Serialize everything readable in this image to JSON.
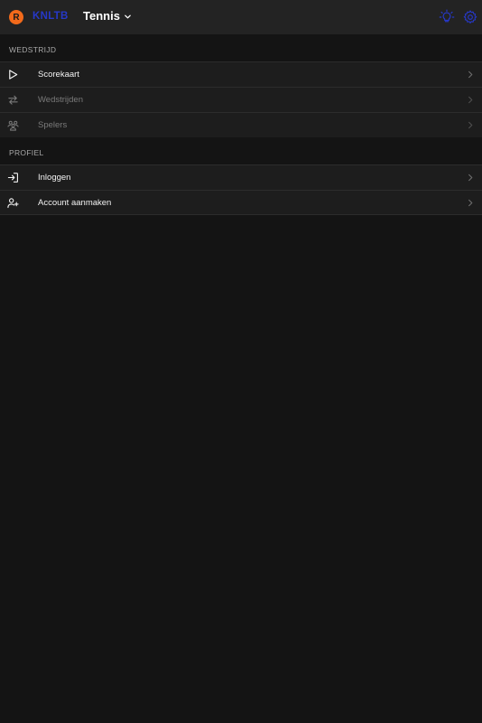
{
  "header": {
    "logo_letter": "R",
    "brand": "KNLTB",
    "sport": "Tennis",
    "icons": [
      "lightbulb-icon",
      "gear-icon"
    ],
    "colors": {
      "logo": "#f26a1b",
      "brand": "#2638c9",
      "icon_accent": "#2638c9"
    }
  },
  "wedstrijd": {
    "title": "WEDSTRIJD",
    "items": [
      {
        "label": "Scorekaart",
        "icon": "play-icon",
        "enabled": true
      },
      {
        "label": "Wedstrijden",
        "icon": "swap-arrows-icon",
        "enabled": false
      },
      {
        "label": "Spelers",
        "icon": "players-icon",
        "enabled": false
      }
    ]
  },
  "profiel": {
    "title": "PROFIEL",
    "items": [
      {
        "label": "Inloggen",
        "icon": "login-icon",
        "enabled": true
      },
      {
        "label": "Account aanmaken",
        "icon": "add-user-icon",
        "enabled": true
      }
    ]
  }
}
